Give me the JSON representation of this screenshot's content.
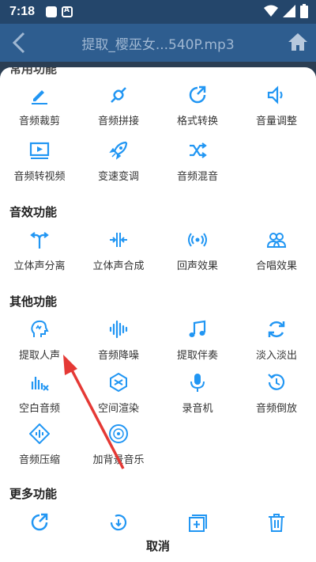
{
  "status_bar": {
    "time": "7:18",
    "notif_badge": "A"
  },
  "app_bar": {
    "title": "提取_樱巫女...540P.mp3"
  },
  "sections": {
    "common": {
      "title": "常用功能"
    },
    "effects": {
      "title": "音效功能"
    },
    "other": {
      "title": "其他功能"
    },
    "more": {
      "title": "更多功能"
    }
  },
  "items": {
    "audio_trim": "音频裁剪",
    "audio_join": "音频拼接",
    "format_convert": "格式转换",
    "volume_adjust": "音量调整",
    "audio_to_video": "音频转视频",
    "speed_pitch": "变速变调",
    "audio_mix": "音频混音",
    "stereo_split": "立体声分离",
    "stereo_merge": "立体声合成",
    "echo_effect": "回声效果",
    "chorus_effect": "合唱效果",
    "extract_vocal": "提取人声",
    "noise_reduce": "音频降噪",
    "extract_accomp": "提取伴奏",
    "fade_in_out": "淡入淡出",
    "blank_audio": "空白音频",
    "spatial_render": "空间渲染",
    "recorder": "录音机",
    "audio_reverse": "音频倒放",
    "audio_compress": "音频压缩",
    "add_bgm": "加背景音乐"
  },
  "cancel_label": "取消",
  "colors": {
    "accent": "#2196f3",
    "appbar": "#2e5d8f",
    "arrow": "#e53935"
  }
}
